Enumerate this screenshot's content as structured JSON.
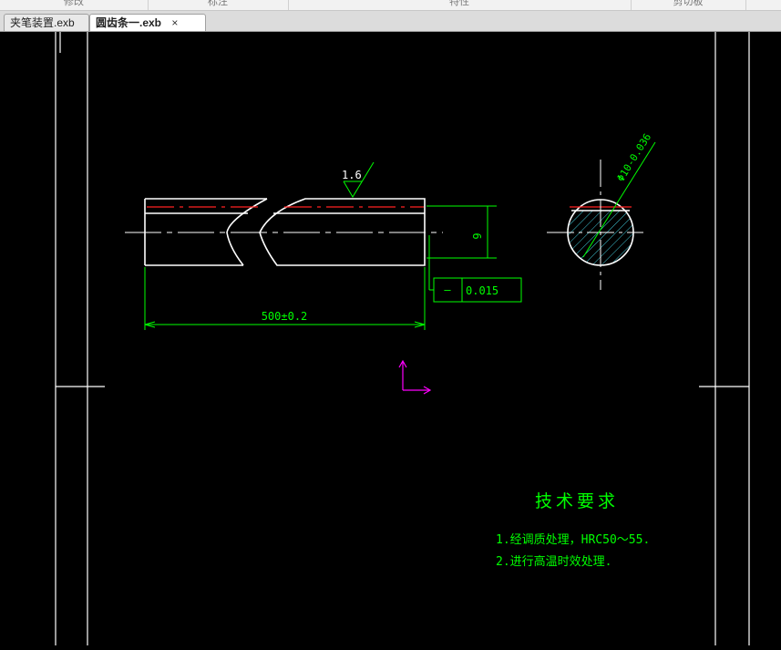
{
  "ribbon": {
    "groups": [
      "修改",
      "标注",
      "特性",
      "剪切板"
    ]
  },
  "tabs": [
    {
      "label": "夹笔装置.exb",
      "active": false
    },
    {
      "label": "圆齿条一.exb",
      "active": true,
      "close": "×"
    }
  ],
  "drawing": {
    "roughness": "1.6",
    "diameter_dim": "9",
    "length_dim": "500±0.2",
    "tolerance_symbol": "—",
    "tolerance_value": "0.015",
    "section_dim": "Φ10-0.036",
    "tech_title": "技术要求",
    "tech_notes": [
      "1.经调质处理，HRC50～55.",
      "2.进行高温时效处理."
    ]
  },
  "colors": {
    "outline": "#ffffff",
    "dimension": "#00ff00",
    "hidden_line": "#ff2020",
    "ucs": "#ff00ff",
    "hatch": "#40c8d8"
  }
}
